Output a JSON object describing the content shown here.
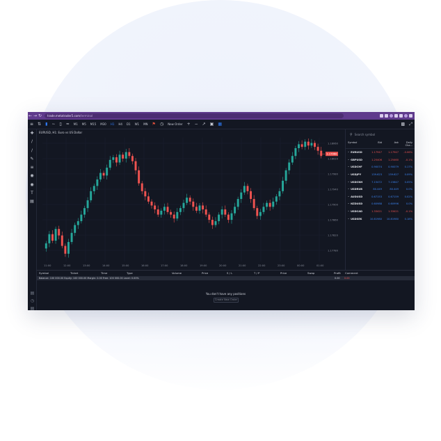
{
  "browser": {
    "url_host": "trade.metatrader5.com",
    "url_path": "/terminal"
  },
  "toolbar": {
    "items": [
      "M1",
      "M5",
      "M15",
      "M30",
      "H1",
      "H4",
      "D1",
      "W1",
      "MN"
    ],
    "active": "H1",
    "new_order": "New Order"
  },
  "chart": {
    "legend": "EURUSD, H1: Euro vs US Dollar",
    "current_price_label": "1.17960",
    "time_labels": [
      "11:00",
      "12:00",
      "13:00",
      "14:00",
      "15:00",
      "16:00",
      "17:00",
      "18:00",
      "19:00",
      "20:00",
      "21:00",
      "22:00",
      "23:00",
      "00:00",
      "01:00"
    ],
    "price_labels": [
      "1.18060",
      "1.18020",
      "1.17980",
      "1.17940",
      "1.17900",
      "1.17860",
      "1.17820",
      "1.17780"
    ],
    "colors": {
      "up": "#26a69a",
      "down": "#ef5350",
      "bg": "#131722"
    }
  },
  "chart_data": {
    "type": "candlestick",
    "symbol": "EURUSD",
    "timeframe": "H1",
    "close": [
      1.1784,
      1.1791,
      1.1786,
      1.1795,
      1.179,
      1.1782,
      1.1776,
      1.1785,
      1.1792,
      1.1798,
      1.1801,
      1.1806,
      1.1811,
      1.1817,
      1.1824,
      1.1828,
      1.1833,
      1.1838,
      1.1836,
      1.1842,
      1.1848,
      1.185,
      1.1846,
      1.1852,
      1.1849,
      1.1854,
      1.1851,
      1.1847,
      1.184,
      1.183,
      1.1824,
      1.182,
      1.1816,
      1.1813,
      1.181,
      1.1806,
      1.1809,
      1.1812,
      1.1808,
      1.1806,
      1.1803,
      1.1808,
      1.1811,
      1.1815,
      1.1819,
      1.1816,
      1.1812,
      1.1809,
      1.1813,
      1.181,
      1.1806,
      1.1802,
      1.1798,
      1.1801,
      1.1806,
      1.181,
      1.1806,
      1.1802,
      1.1807,
      1.1812,
      1.1818,
      1.1823,
      1.1828,
      1.1824,
      1.1818,
      1.1811,
      1.1805,
      1.1808,
      1.1812,
      1.1815,
      1.1812,
      1.1816,
      1.182,
      1.1824,
      1.1832,
      1.184,
      1.1846,
      1.1851,
      1.1857,
      1.186,
      1.1858,
      1.1862,
      1.1859,
      1.1861,
      1.1858,
      1.1855,
      1.1851
    ]
  },
  "watchlist": {
    "search_placeholder": "Search symbol",
    "columns": [
      "Symbol",
      "Bid",
      "Ask",
      "Daily Cha..."
    ],
    "rows": [
      {
        "symbol": "EURUSD",
        "bid": "1.17947",
        "ask": "1.17947",
        "change": "-0.06%",
        "dir": "dn"
      },
      {
        "symbol": "GBPUSD",
        "bid": "1.25406",
        "ask": "1.25460",
        "change": "-0.1%",
        "dir": "dn"
      },
      {
        "symbol": "USDCHF",
        "bid": "0.90074",
        "ask": "0.90079",
        "change": "0.17%",
        "dir": "up"
      },
      {
        "symbol": "USDJPY",
        "bid": "139.623",
        "ask": "139.627",
        "change": "0.09%",
        "dir": "up"
      },
      {
        "symbol": "USDCNH",
        "bid": "7.15472",
        "ask": "7.15647",
        "change": "0.05%",
        "dir": "up"
      },
      {
        "symbol": "USDRUB",
        "bid": "80.449",
        "ask": "80.449",
        "change": "0.0%",
        "dir": "up"
      },
      {
        "symbol": "AUDUSD",
        "bid": "0.67153",
        "ask": "0.67159",
        "change": "0.02%",
        "dir": "up"
      },
      {
        "symbol": "NZDUSD",
        "bid": "0.60988",
        "ask": "0.60996",
        "change": "0.0%",
        "dir": "up"
      },
      {
        "symbol": "USDCAD",
        "bid": "1.33421",
        "ask": "1.33421",
        "change": "-0.1%",
        "dir": "dn"
      },
      {
        "symbol": "USDSEK",
        "bid": "10.81980",
        "ask": "10.81980",
        "change": "0.18%",
        "dir": "up"
      }
    ]
  },
  "positions": {
    "columns": [
      "Symbol",
      "Ticket",
      "Time",
      "Type",
      "Volume",
      "Price",
      "S / L",
      "T / P",
      "Price",
      "Swap",
      "Profit",
      "Comment"
    ],
    "balance_line": "Balance: 100 000.00   Equity: 100 000.00   Margin: 0.00   Free: 100 000.00   Level: 0.00%",
    "profit_value": "0.00",
    "profit_value2": "0.00",
    "empty_text": "You don't have any positions",
    "new_order_button": "Create New Order"
  }
}
